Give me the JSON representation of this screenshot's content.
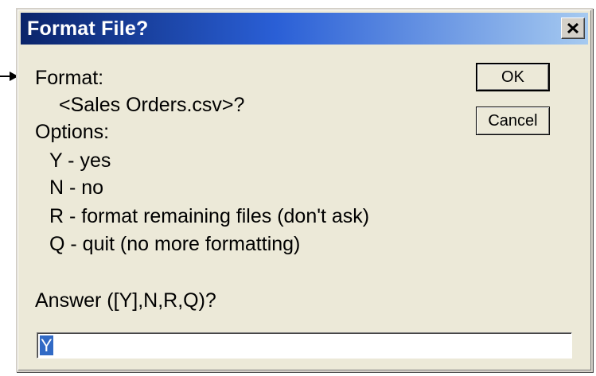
{
  "window": {
    "title": "Format File?",
    "close_icon": "close-icon"
  },
  "message": {
    "format_label": "Format:",
    "file_name": "<Sales Orders.csv>?",
    "options_label": "Options:",
    "options": [
      "Y - yes",
      "N - no",
      "R - format remaining files (don't ask)",
      "Q - quit (no more formatting)"
    ],
    "prompt": "Answer ([Y],N,R,Q)?"
  },
  "buttons": {
    "ok_label": "OK",
    "cancel_label": "Cancel"
  },
  "answer": {
    "value": "Y"
  },
  "colors": {
    "title_bar_start": "#0a246a",
    "title_bar_end": "#a6caf0",
    "dialog_face": "#ece9d8",
    "selection": "#316ac5"
  }
}
